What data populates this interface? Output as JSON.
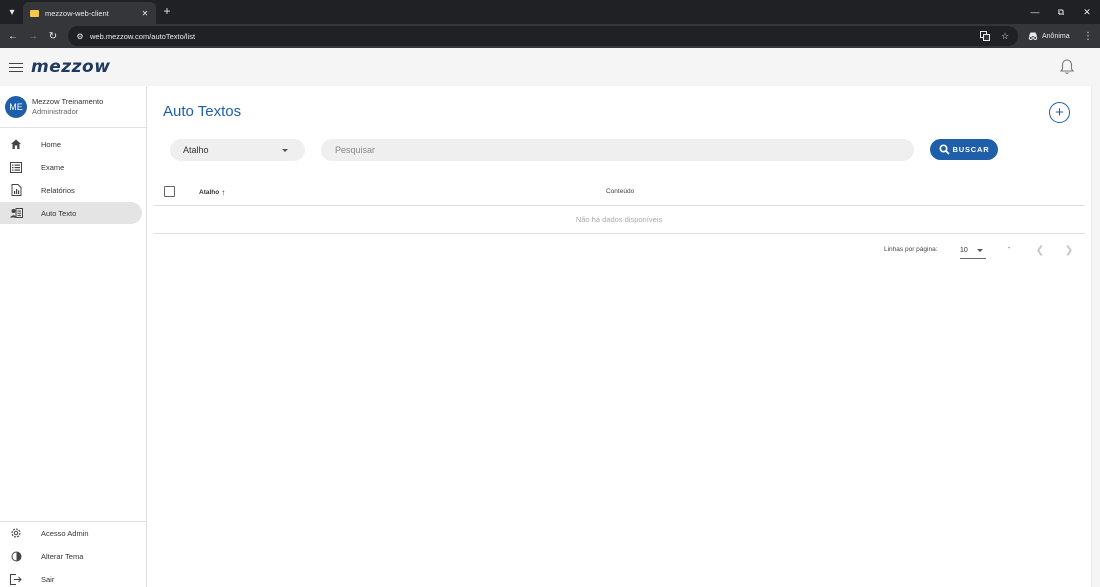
{
  "browser": {
    "tab_title": "mezzow-web-client",
    "url": "web.mezzow.com/autoTexto/list",
    "profile_label": "Anônima"
  },
  "app": {
    "logo": "mezzow"
  },
  "sidebar": {
    "avatar_initials": "ME",
    "user_name": "Mezzow Treinamento",
    "user_role": "Administrador",
    "items": [
      {
        "label": "Home",
        "icon": "home-icon"
      },
      {
        "label": "Exame",
        "icon": "list-icon"
      },
      {
        "label": "Relatórios",
        "icon": "report-icon"
      },
      {
        "label": "Auto Texto",
        "icon": "contact-card-icon",
        "active": true
      }
    ],
    "bottom_items": [
      {
        "label": "Acesso Admin",
        "icon": "gear-icon"
      },
      {
        "label": "Alterar Tema",
        "icon": "theme-icon"
      },
      {
        "label": "Sair",
        "icon": "logout-icon"
      }
    ]
  },
  "main": {
    "title": "Auto Textos",
    "filter_select_value": "Atalho",
    "search_placeholder": "Pesquisar",
    "search_button": "BUSCAR",
    "table": {
      "columns": [
        "Atalho",
        "Conteúdo"
      ],
      "sort_column": "Atalho",
      "empty_text": "Não há dados disponíveis"
    },
    "pagination": {
      "rows_label": "Linhas por página:",
      "rows_per_page": "10",
      "range_text": "-"
    }
  },
  "colors": {
    "accent": "#1f5fa9",
    "logo": "#1f3a5f"
  }
}
